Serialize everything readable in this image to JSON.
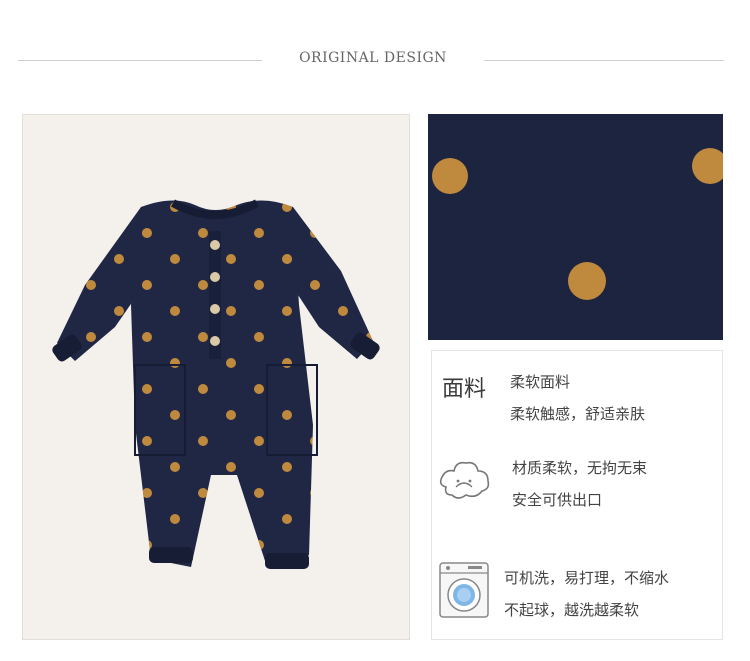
{
  "header": {
    "title": "ORIGINAL DESIGN"
  },
  "images": {
    "product_photo": "navy-polka-dot-baby-romper",
    "detail_photo": "fabric-closeup-polka-dots"
  },
  "features": {
    "fabric_label": "面料",
    "fabric_line1": "柔软面料",
    "fabric_line2": "柔软触感，舒适亲肤",
    "soft_line1": "材质柔软，无拘无束",
    "soft_line2": "安全可供出口",
    "wash_line1": "可机洗，易打理，不缩水",
    "wash_line2": "不起球，越洗越柔软"
  },
  "icons": {
    "soft": "cloud-icon",
    "wash": "washing-machine-icon"
  },
  "colors": {
    "navy": "#1f2744",
    "dot": "#c08a3e"
  }
}
